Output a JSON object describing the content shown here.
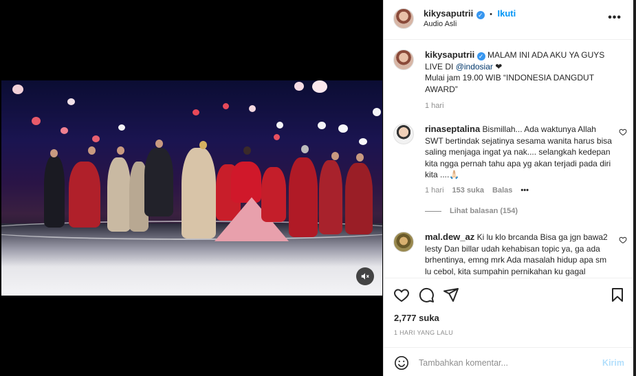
{
  "header": {
    "username": "kikysaputrii",
    "separator": "•",
    "follow_label": "Ikuti",
    "subtitle": "Audio Asli",
    "more_icon": "more-horizontal-icon"
  },
  "caption": {
    "username": "kikysaputrii",
    "text_before": "MALAM INI ADA AKU YA GUYS LIVE DI ",
    "mention": "@indosiar",
    "text_after": " ❤",
    "line2": "Mulai jam 19.00 WIB “INDONESIA DANGDUT AWARD”",
    "time": "1 hari"
  },
  "comments": [
    {
      "username": "rinaseptalina",
      "text": "Bismillah... Ada waktunya Allah SWT bertindak sejatinya sesama wanita harus bisa saling menjaga ingat ya nak.... selangkah kedepan kita ngga pernah tahu apa yg akan terjadi pada diri kita ....🙏🏻",
      "time": "1 hari",
      "likes": "153 suka",
      "reply": "Balas",
      "options": "•••",
      "view_replies": "Lihat balasan (154)"
    },
    {
      "username": "mal.dew_az",
      "text": "Ki lu klo brcanda Bisa ga jgn bawa2 lesty Dan billar udah kehabisan topic ya, ga ada brhentinya, emng mrk Ada masalah hidup apa sm lu cebol, kita sumpahin pernikahan ku gagal"
    }
  ],
  "actions": {
    "like_icon": "heart-icon",
    "comment_icon": "comment-icon",
    "share_icon": "share-icon",
    "save_icon": "bookmark-icon",
    "likes_count": "2,777 suka",
    "posted_ago": "1 HARI YANG LALU"
  },
  "composer": {
    "emoji_icon": "emoji-icon",
    "placeholder": "Tambahkan komentar...",
    "post_label": "Kirim"
  },
  "video": {
    "mute_icon": "muted-speaker-icon"
  }
}
